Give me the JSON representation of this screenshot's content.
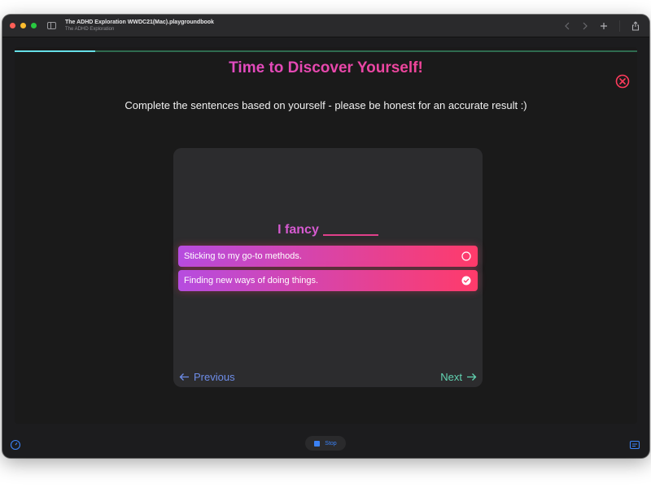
{
  "window": {
    "title": "The ADHD Exploration WWDC21(Mac).playgroundbook",
    "subtitle": "The ADHD Exploration"
  },
  "toolbar": {
    "back_icon": "chevron-left-icon",
    "forward_icon": "chevron-right-icon",
    "add_icon": "plus-icon",
    "share_icon": "share-icon"
  },
  "progress": {
    "fraction": 0.13
  },
  "page": {
    "heading": "Time to Discover Yourself!",
    "subheading": "Complete the sentences based on yourself - please be honest for an accurate result :)"
  },
  "question": {
    "prompt": "I fancy",
    "options": [
      {
        "label": "Sticking to my go-to methods.",
        "selected": false
      },
      {
        "label": "Finding new ways of doing things.",
        "selected": true
      }
    ]
  },
  "navigation": {
    "previous_label": "Previous",
    "next_label": "Next"
  },
  "bottom_bar": {
    "stop_label": "Stop"
  },
  "colors": {
    "accent_gradient_start": "#b64ce0",
    "accent_gradient_end": "#ff3b6a",
    "previous": "#6e8de8",
    "next": "#62d4b2",
    "stop": "#3b82f6"
  }
}
